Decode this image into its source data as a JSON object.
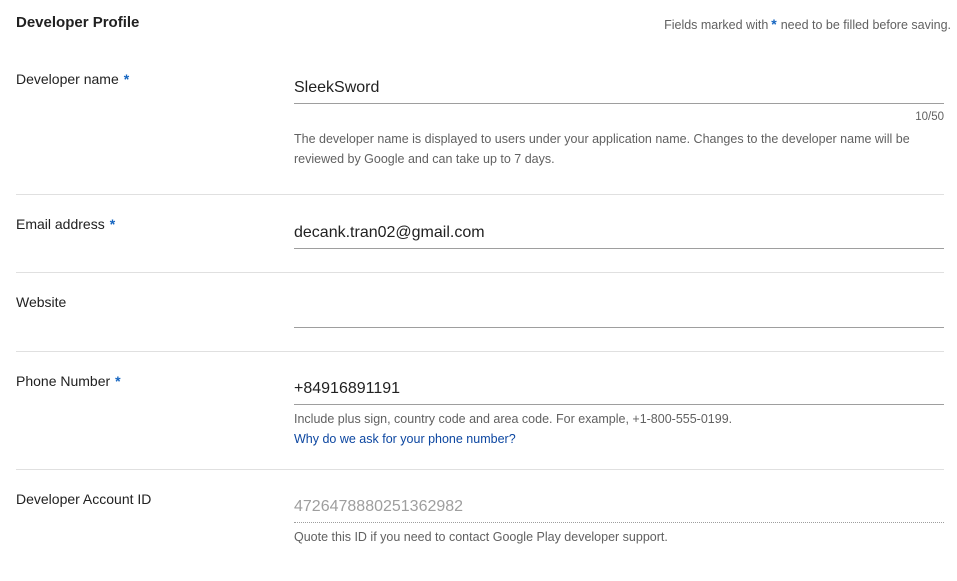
{
  "header": {
    "title": "Developer Profile",
    "required_note_prefix": "Fields marked with",
    "required_note_star": "*",
    "required_note_suffix": "need to be filled before saving."
  },
  "fields": {
    "developer_name": {
      "label": "Developer name",
      "required_star": "*",
      "value": "SleekSword",
      "counter": "10/50",
      "help": "The developer name is displayed to users under your application name. Changes to the developer name will be reviewed by Google and can take up to 7 days."
    },
    "email": {
      "label": "Email address",
      "required_star": "*",
      "value": "decank.tran02@gmail.com"
    },
    "website": {
      "label": "Website",
      "value": ""
    },
    "phone": {
      "label": "Phone Number",
      "required_star": "*",
      "value": "+84916891191",
      "help": "Include plus sign, country code and area code. For example, +1-800-555-0199.",
      "link": "Why do we ask for your phone number?"
    },
    "account_id": {
      "label": "Developer Account ID",
      "value": "4726478880251362982",
      "help": "Quote this ID if you need to contact Google Play developer support."
    }
  },
  "colors": {
    "accent": "#1565c0",
    "link": "#0d47a1",
    "text": "#212121",
    "secondary_text": "#616161",
    "divider": "#e0e0e0"
  }
}
